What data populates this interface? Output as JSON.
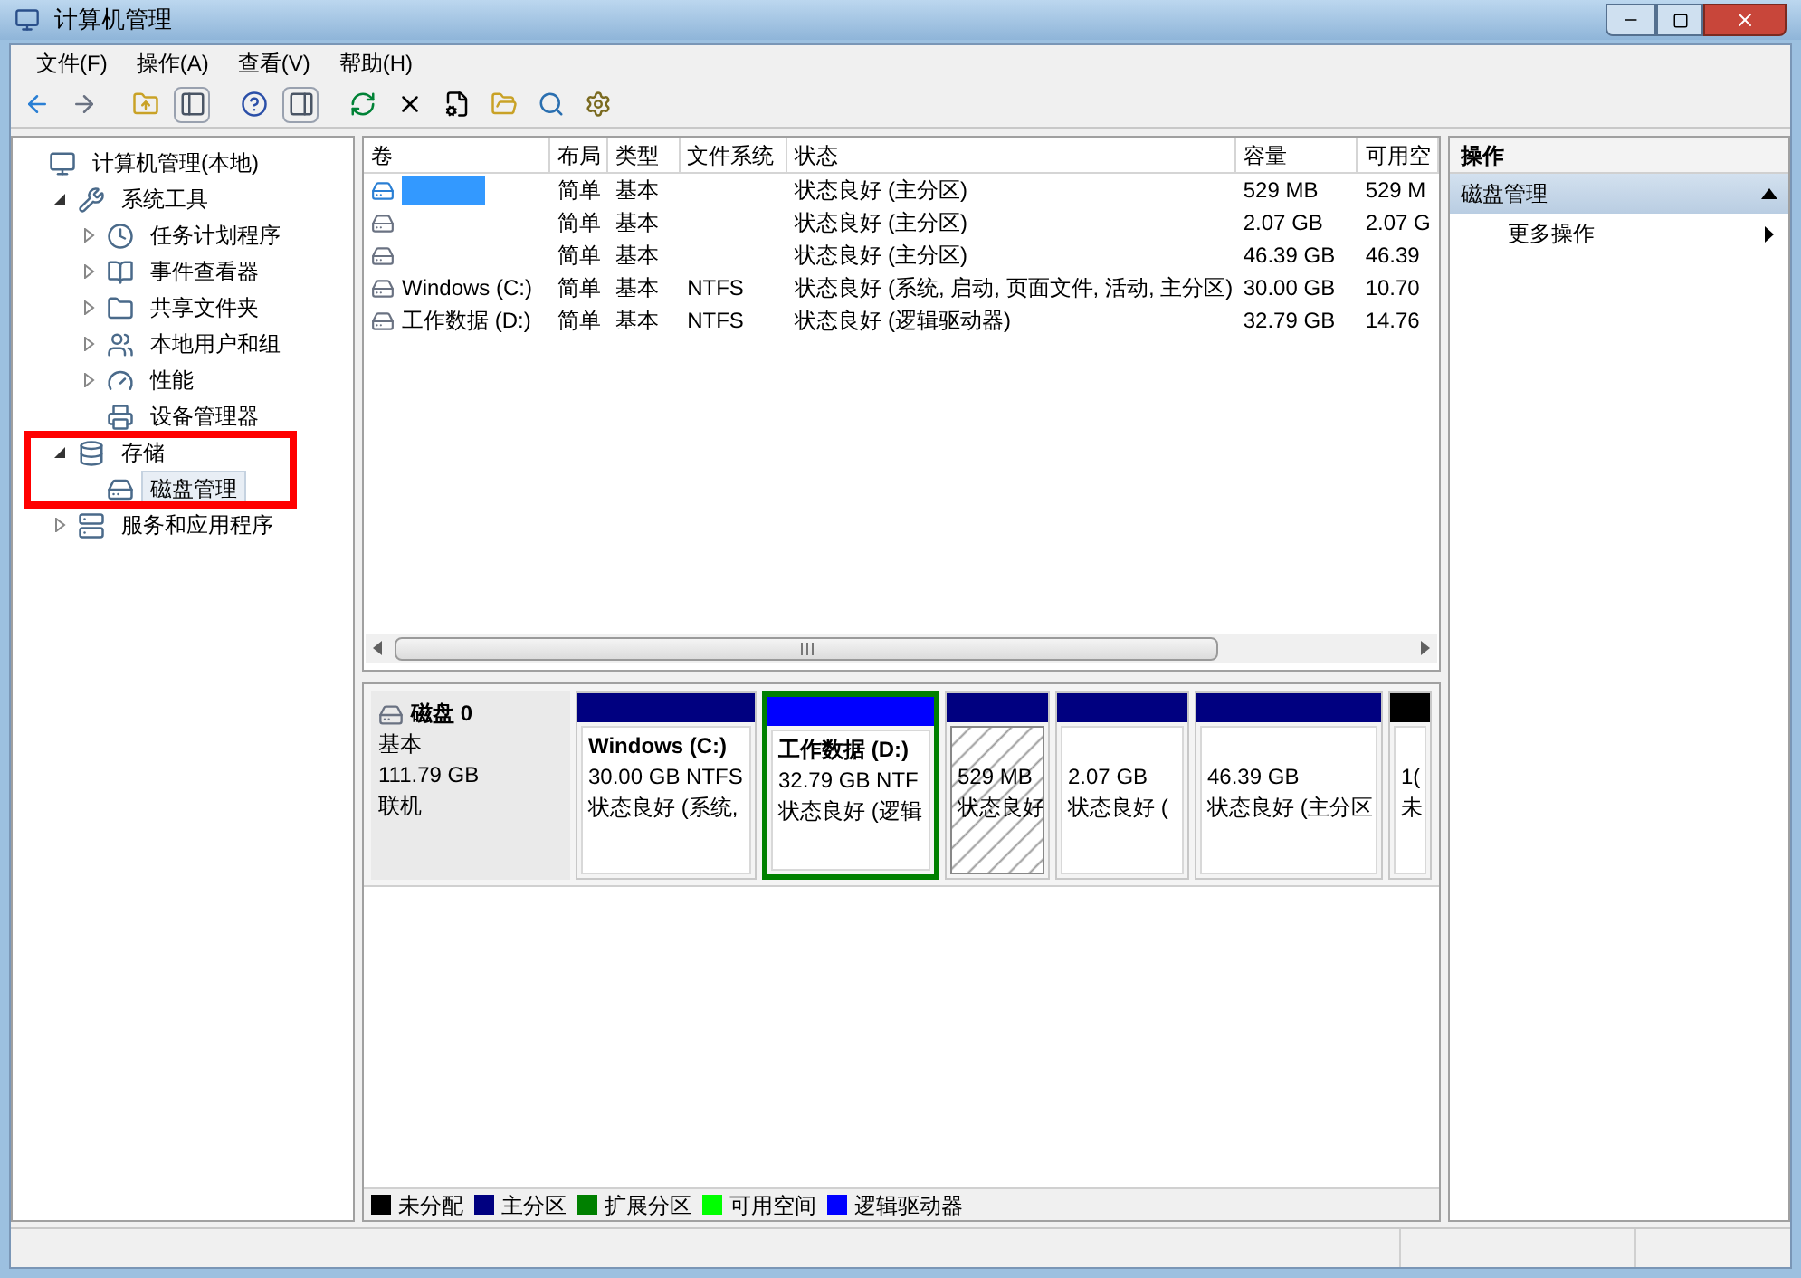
{
  "window": {
    "title": "计算机管理"
  },
  "menu": [
    "文件(F)",
    "操作(A)",
    "查看(V)",
    "帮助(H)"
  ],
  "tree": [
    {
      "label": "计算机管理(本地)",
      "selected": false,
      "children": [
        {
          "label": "系统工具",
          "expanded": true,
          "selected": false,
          "children": [
            {
              "label": "任务计划程序",
              "expanded": false,
              "selected": false
            },
            {
              "label": "事件查看器",
              "expanded": false,
              "selected": false
            },
            {
              "label": "共享文件夹",
              "expanded": false,
              "selected": false
            },
            {
              "label": "本地用户和组",
              "expanded": false,
              "selected": false
            },
            {
              "label": "性能",
              "expanded": false,
              "selected": false
            },
            {
              "label": "设备管理器",
              "selected": false
            }
          ]
        },
        {
          "label": "存储",
          "expanded": true,
          "selected": false,
          "children": [
            {
              "label": "磁盘管理",
              "selected": true
            }
          ]
        },
        {
          "label": "服务和应用程序",
          "expanded": false,
          "selected": false
        }
      ]
    }
  ],
  "table": {
    "columns": [
      "卷",
      "布局",
      "类型",
      "文件系统",
      "状态",
      "容量",
      "可用空"
    ],
    "rows": [
      {
        "selected": true,
        "layout": "简单",
        "type": "基本",
        "status": "状态良好 (主分区)",
        "capacity": "529 MB",
        "free": "529 M"
      },
      {
        "selected": false,
        "layout": "简单",
        "type": "基本",
        "status": "状态良好 (主分区)",
        "capacity": "2.07 GB",
        "free": "2.07 G"
      },
      {
        "selected": false,
        "layout": "简单",
        "type": "基本",
        "status": "状态良好 (主分区)",
        "capacity": "46.39 GB",
        "free": "46.39"
      },
      {
        "selected": false,
        "volume": "Windows (C:)",
        "layout": "简单",
        "type": "基本",
        "filesystem": "NTFS",
        "status": "状态良好 (系统, 启动, 页面文件, 活动, 主分区)",
        "capacity": "30.00 GB",
        "free": "10.70"
      },
      {
        "selected": false,
        "volume": "工作数据 (D:)",
        "layout": "简单",
        "type": "基本",
        "filesystem": "NTFS",
        "status": "状态良好 (逻辑驱动器)",
        "capacity": "32.79 GB",
        "free": "14.76"
      }
    ]
  },
  "disk": {
    "name": "磁盘 0",
    "type": "基本",
    "size": "111.79 GB",
    "state": "联机",
    "partitions": [
      {
        "kind": "primary",
        "selected": false,
        "color": "#000080",
        "title": "Windows  (C:)",
        "size": "30.00 GB NTFS",
        "status": "状态良好 (系统,"
      },
      {
        "kind": "logical",
        "selected": false,
        "color": "#0000ff",
        "title": "工作数据  (D:)",
        "size": "32.79 GB NTF",
        "status": "状态良好 (逻辑"
      },
      {
        "kind": "primary",
        "selected": true,
        "color": "#000080",
        "size": "529 MB",
        "status": "状态良好"
      },
      {
        "kind": "primary",
        "selected": false,
        "color": "#000080",
        "size": "2.07 GB",
        "status": "状态良好 ("
      },
      {
        "kind": "primary",
        "selected": false,
        "color": "#000080",
        "size": "46.39 GB",
        "status": "状态良好 (主分区"
      },
      {
        "kind": "unallocated",
        "selected": false,
        "color": "#000000",
        "size": "1(",
        "status": "未"
      }
    ]
  },
  "legend": [
    {
      "label": "未分配",
      "color": "#000000"
    },
    {
      "label": "主分区",
      "color": "#000080"
    },
    {
      "label": "扩展分区",
      "color": "#008000"
    },
    {
      "label": "可用空间",
      "color": "#00ff00"
    },
    {
      "label": "逻辑驱动器",
      "color": "#0000ff"
    }
  ],
  "actions": {
    "title": "操作",
    "section": {
      "label": "磁盘管理",
      "expanded": true
    },
    "items": [
      "更多操作"
    ]
  }
}
